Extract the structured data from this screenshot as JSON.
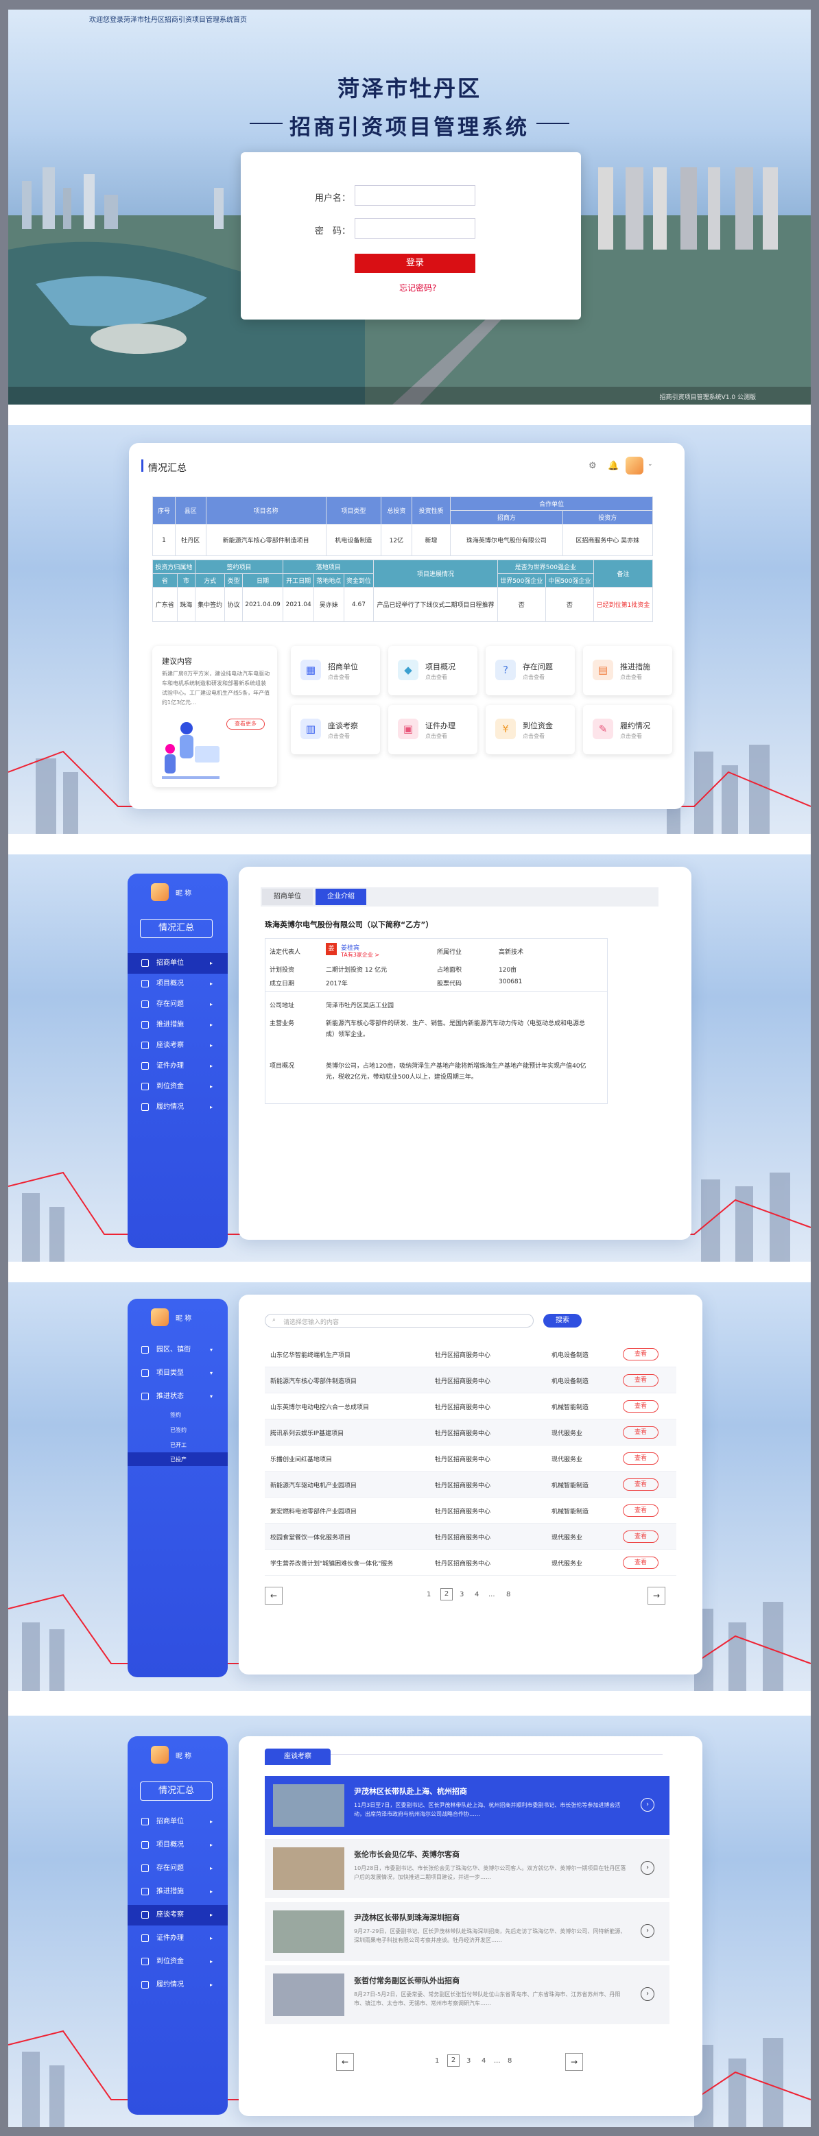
{
  "hero": {
    "top_text": "欢迎您登录菏泽市牡丹区招商引资项目管理系统首页",
    "title1": "菏泽市牡丹区",
    "title2": "招商引资项目管理系统",
    "username_label": "用户名：",
    "password_label": "密　码：",
    "login_button": "登录",
    "forgot": "忘记密码?",
    "footer": "招商引资项目管理系统V1.0 公测版"
  },
  "summary": {
    "title": "情况汇总",
    "table1_headers": [
      "序号",
      "县区",
      "项目名称",
      "项目类型",
      "总投资",
      "投资性质",
      "合作单位"
    ],
    "table1_sub": [
      "招商方",
      "投资方"
    ],
    "table1_row": [
      "1",
      "牡丹区",
      "新能源汽车核心零部件制造项目",
      "机电设备制造",
      "12亿",
      "新增",
      "珠海英博尔电气股份有限公司",
      "区招商服务中心 吴亦妹"
    ],
    "table2_group": [
      "投资方归属地",
      "签约项目",
      "落地项目",
      "项目进展情况",
      "是否为世界500强企业",
      "备注"
    ],
    "table2_sub": [
      "省",
      "市",
      "方式",
      "类型",
      "日期",
      "开工日期",
      "落地地点",
      "资金到位",
      "世界500强企业",
      "中国500强企业"
    ],
    "table2_row": [
      "广东省",
      "珠海",
      "集中签约",
      "协议",
      "2021.04.09",
      "2021.04",
      "吴亦妹",
      "4.67",
      "产品已经举行了下线仪式二期项目日程推荐",
      "否",
      "否",
      "已经到位第1批资金"
    ],
    "advice": {
      "title": "建议内容",
      "text": "新建厂房8万平方米，建设纯电动汽车电驱动车和电机系统制造和研发和部署新系统组装试验中心。工厂建设电机生产线5条，年产值约1亿3亿元...",
      "more": "查看更多"
    },
    "cards": [
      {
        "title": "招商单位",
        "sub": "点击查看"
      },
      {
        "title": "项目概况",
        "sub": "点击查看"
      },
      {
        "title": "存在问题",
        "sub": "点击查看"
      },
      {
        "title": "推进措施",
        "sub": "点击查看"
      },
      {
        "title": "座谈考察",
        "sub": "点击查看"
      },
      {
        "title": "证件办理",
        "sub": "点击查看"
      },
      {
        "title": "到位资金",
        "sub": "点击查看"
      },
      {
        "title": "履约情况",
        "sub": "点击查看"
      }
    ]
  },
  "sidebar": {
    "user": "昵 称",
    "summary_button": "情况汇总",
    "items": [
      "招商单位",
      "项目概况",
      "存在问题",
      "推进措施",
      "座谈考察",
      "证件办理",
      "到位资金",
      "履约情况"
    ]
  },
  "company": {
    "tabs": [
      "招商单位",
      "企业介绍"
    ],
    "name": "珠海英博尔电气股份有限公司（以下简称“乙方”）",
    "legal_label": "法定代表人",
    "legal_name": "姜桂宾",
    "legal_sub": "TA有3家企业 >",
    "industry_label": "所属行业",
    "industry": "高新技术",
    "capital_label": "计划投资",
    "capital": "二期计划投资 12 亿元",
    "area_label": "占地面积",
    "area": "120亩",
    "date_label": "成立日期",
    "date": "2017年",
    "code_label": "股票代码",
    "code": "300681",
    "addr_label": "公司地址",
    "addr": "菏泽市牡丹区吴店工业园",
    "biz_label": "主营业务",
    "biz": "新能源汽车核心零部件的研发、生产、销售。是国内新能源汽车动力传动（电驱动总成和电源总成）领军企业。",
    "intro_label": "项目概况",
    "intro": "英博尔公司，占地120亩，吸纳菏泽生产基地产能将新增珠海生产基地产能预计年实现产值40亿元，税收2亿元，带动就业500人以上，建设周期三年。"
  },
  "list": {
    "search_placeholder": "请选择您输入的内容",
    "search_button": "搜索",
    "side_items": [
      "园区、镇街",
      "项目类型",
      "推进状态"
    ],
    "side_subs": [
      "签约",
      "已签约",
      "已开工",
      "已投产"
    ],
    "rows": [
      {
        "name": "山东亿华智能终端机生产项目",
        "unit": "牡丹区招商服务中心",
        "type": "机电设备制造"
      },
      {
        "name": "新能源汽车核心零部件制造项目",
        "unit": "牡丹区招商服务中心",
        "type": "机电设备制造"
      },
      {
        "name": "山东英博尔电动电控六合一总成项目",
        "unit": "牡丹区招商服务中心",
        "type": "机械智能制造"
      },
      {
        "name": "腾讯系列云娱乐IP基建项目",
        "unit": "牡丹区招商服务中心",
        "type": "现代服务业"
      },
      {
        "name": "乐播创业间红基地项目",
        "unit": "牡丹区招商服务中心",
        "type": "现代服务业"
      },
      {
        "name": "新能源汽车驱动电机产业园项目",
        "unit": "牡丹区招商服务中心",
        "type": "机械智能制造"
      },
      {
        "name": "复宏燃料电池零部件产业园项目",
        "unit": "牡丹区招商服务中心",
        "type": "机械智能制造"
      },
      {
        "name": "校园食堂餐饮一体化服务项目",
        "unit": "牡丹区招商服务中心",
        "type": "现代服务业"
      },
      {
        "name": "学生营养改善计划\"城镇困难伙食一体化\"服务",
        "unit": "牡丹区招商服务中心",
        "type": "现代服务业"
      }
    ],
    "view": "查看",
    "pages": [
      "1",
      "2",
      "3",
      "4",
      "...",
      "8"
    ]
  },
  "news": {
    "tab": "座谈考察",
    "items": [
      {
        "title": "尹茂林区长带队赴上海、杭州招商",
        "text": "11月3日至7日，区委副书记、区长尹茂林带队赴上海、杭州招商并顺利市委副书记、市长张伦等参加进博会活动，出席菏泽市政府与杭州海尔公司战略合作协……"
      },
      {
        "title": "张伦市长会见亿华、英博尔客商",
        "text": "10月28日，市委副书记、市长张伦会见了珠海亿华、英博尔公司客人。双方就亿华、英博尔一期项目在牡丹区落户后的发展情况，加快推进二期项目建设，并进一步……"
      },
      {
        "title": "尹茂林区长带队到珠海深圳招商",
        "text": "9月27-29日，区委副书记、区长尹茂林带队赴珠海深圳招商，先后走访了珠海亿华、英博尔公司、同特新能源、深圳雨果电子科技有限公司考察并座谈。牡丹经济开发区……"
      },
      {
        "title": "张哲付常务副区长带队外出招商",
        "text": "8月27日-5月2日，区委常委、常务副区长张哲付带队赴位山东省青岛市、广东省珠海市、江苏省苏州市、丹阳市、镇江市、太仓市、无锡市、常州市考察调研汽车……"
      }
    ],
    "pages": [
      "1",
      "2",
      "3",
      "4",
      "...",
      "8"
    ]
  },
  "colors": {
    "accent": "#2f4fe0",
    "red": "#d90f14"
  }
}
